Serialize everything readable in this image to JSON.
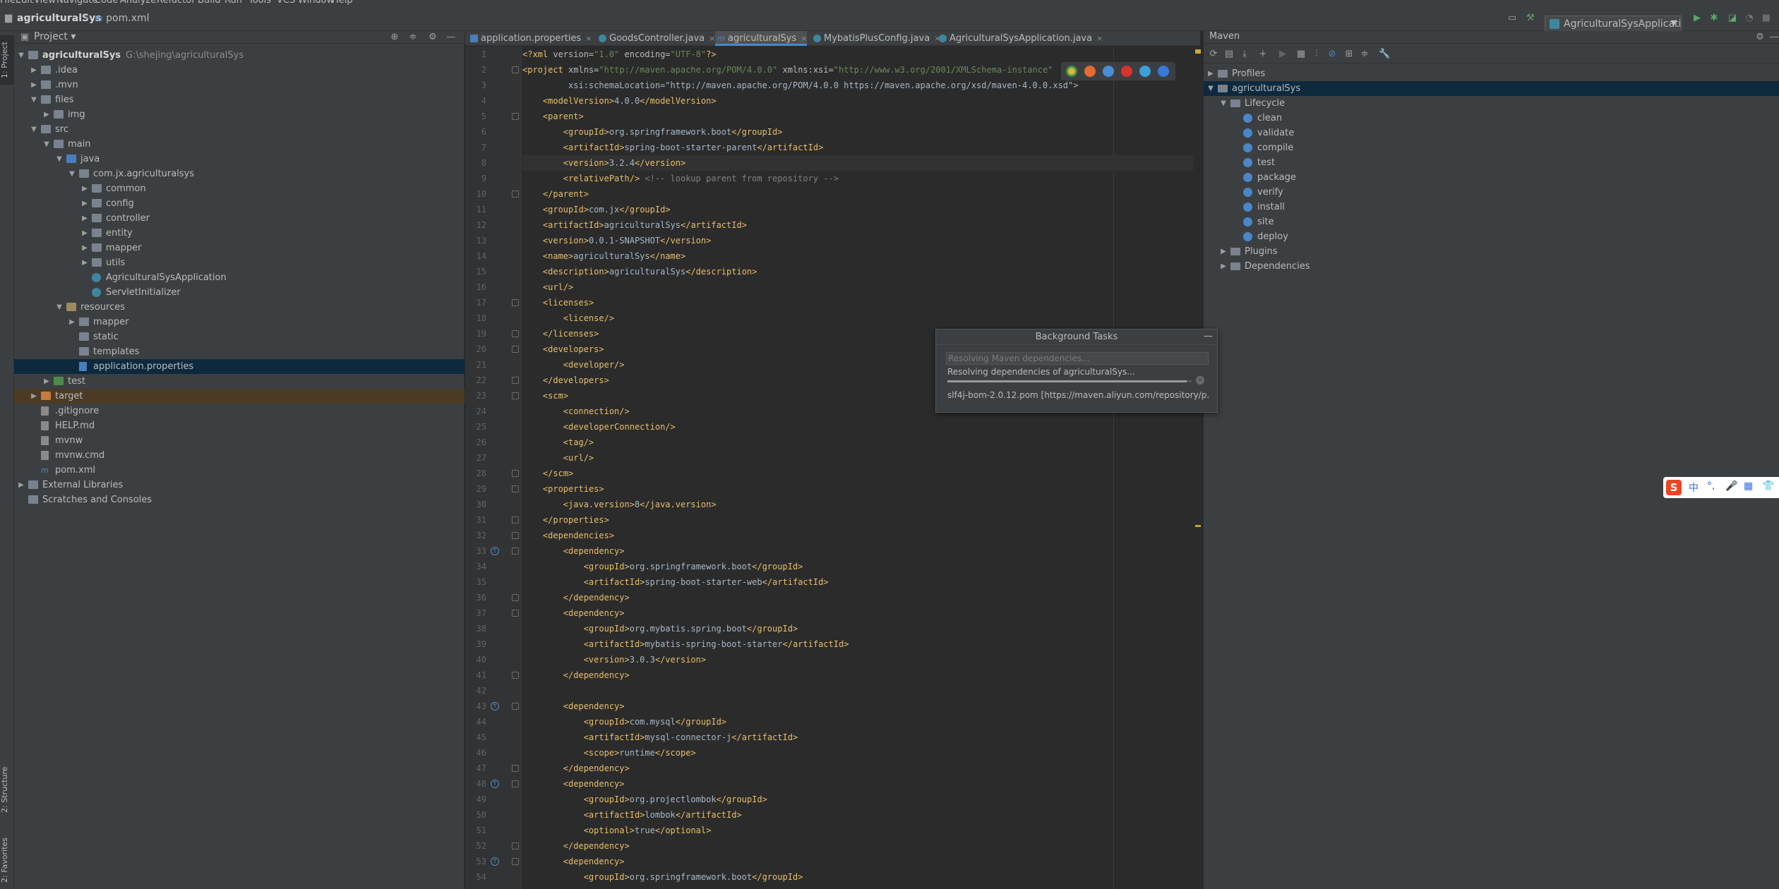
{
  "menu": [
    "File",
    "Edit",
    "View",
    "Navigate",
    "Code",
    "Analyze",
    "Refactor",
    "Build",
    "Run",
    "Tools",
    "VCS",
    "Window",
    "Help"
  ],
  "breadcrumb": {
    "project": "agriculturalSys",
    "file": "pom.xml"
  },
  "run_config": "AgriculturalSysApplication",
  "left_stripe": {
    "project": "1: Project",
    "structure": "2: Structure",
    "favorites": "2: Favorites"
  },
  "project_panel": {
    "title": "Project",
    "tree": [
      {
        "label": "agriculturalSys",
        "path": "G:\\shejing\\agriculturalSys",
        "depth": 0,
        "arrow": "▼",
        "icon": "folder",
        "bold": true
      },
      {
        "label": ".idea",
        "depth": 1,
        "arrow": "▶",
        "icon": "folder"
      },
      {
        "label": ".mvn",
        "depth": 1,
        "arrow": "▶",
        "icon": "folder"
      },
      {
        "label": "files",
        "depth": 1,
        "arrow": "▼",
        "icon": "folder"
      },
      {
        "label": "img",
        "depth": 2,
        "arrow": "▶",
        "icon": "folder"
      },
      {
        "label": "src",
        "depth": 1,
        "arrow": "▼",
        "icon": "folder"
      },
      {
        "label": "main",
        "depth": 2,
        "arrow": "▼",
        "icon": "folder"
      },
      {
        "label": "java",
        "depth": 3,
        "arrow": "▼",
        "icon": "src"
      },
      {
        "label": "com.jx.agriculturalsys",
        "depth": 4,
        "arrow": "▼",
        "icon": "pkg"
      },
      {
        "label": "common",
        "depth": 5,
        "arrow": "▶",
        "icon": "pkg"
      },
      {
        "label": "config",
        "depth": 5,
        "arrow": "▶",
        "icon": "pkg"
      },
      {
        "label": "controller",
        "depth": 5,
        "arrow": "▶",
        "icon": "pkg"
      },
      {
        "label": "entity",
        "depth": 5,
        "arrow": "▶",
        "icon": "pkg"
      },
      {
        "label": "mapper",
        "depth": 5,
        "arrow": "▶",
        "icon": "pkg"
      },
      {
        "label": "utils",
        "depth": 5,
        "arrow": "▶",
        "icon": "pkg"
      },
      {
        "label": "AgriculturalSysApplication",
        "depth": 5,
        "arrow": "",
        "icon": "class"
      },
      {
        "label": "ServletInitializer",
        "depth": 5,
        "arrow": "",
        "icon": "class"
      },
      {
        "label": "resources",
        "depth": 3,
        "arrow": "▼",
        "icon": "res"
      },
      {
        "label": "mapper",
        "depth": 4,
        "arrow": "▶",
        "icon": "folder"
      },
      {
        "label": "static",
        "depth": 4,
        "arrow": "",
        "icon": "folder"
      },
      {
        "label": "templates",
        "depth": 4,
        "arrow": "",
        "icon": "folder"
      },
      {
        "label": "application.properties",
        "depth": 4,
        "arrow": "",
        "icon": "prop",
        "selected": true
      },
      {
        "label": "test",
        "depth": 2,
        "arrow": "▶",
        "icon": "test"
      },
      {
        "label": "target",
        "depth": 1,
        "arrow": "▶",
        "icon": "orange",
        "excluded": true
      },
      {
        "label": ".gitignore",
        "depth": 1,
        "arrow": "",
        "icon": "file"
      },
      {
        "label": "HELP.md",
        "depth": 1,
        "arrow": "",
        "icon": "file"
      },
      {
        "label": "mvnw",
        "depth": 1,
        "arrow": "",
        "icon": "file"
      },
      {
        "label": "mvnw.cmd",
        "depth": 1,
        "arrow": "",
        "icon": "file"
      },
      {
        "label": "pom.xml",
        "depth": 1,
        "arrow": "",
        "icon": "xml"
      },
      {
        "label": "External Libraries",
        "depth": 0,
        "arrow": "▶",
        "icon": "folder"
      },
      {
        "label": "Scratches and Consoles",
        "depth": 0,
        "arrow": "",
        "icon": "folder"
      }
    ]
  },
  "editor_tabs": [
    {
      "label": "application.properties",
      "icon": "prop"
    },
    {
      "label": "GoodsController.java",
      "icon": "class"
    },
    {
      "label": "agriculturalSys",
      "icon": "m",
      "active": true
    },
    {
      "label": "MybatisPlusConfig.java",
      "icon": "class"
    },
    {
      "label": "AgriculturalSysApplication.java",
      "icon": "class"
    }
  ],
  "code_lines": [
    "<?xml version=\"1.0\" encoding=\"UTF-8\"?>",
    "<project xmlns=\"http://maven.apache.org/POM/4.0.0\" xmlns:xsi=\"http://www.w3.org/2001/XMLSchema-instance\"",
    "         xsi:schemaLocation=\"http://maven.apache.org/POM/4.0.0 https://maven.apache.org/xsd/maven-4.0.0.xsd\">",
    "    <modelVersion>4.0.0</modelVersion>",
    "    <parent>",
    "        <groupId>org.springframework.boot</groupId>",
    "        <artifactId>spring-boot-starter-parent</artifactId>",
    "        <version>3.2.4</version>",
    "        <relativePath/> <!-- lookup parent from repository -->",
    "    </parent>",
    "    <groupId>com.jx</groupId>",
    "    <artifactId>agriculturalSys</artifactId>",
    "    <version>0.0.1-SNAPSHOT</version>",
    "    <name>agriculturalSys</name>",
    "    <description>agriculturalSys</description>",
    "    <url/>",
    "    <licenses>",
    "        <license/>",
    "    </licenses>",
    "    <developers>",
    "        <developer/>",
    "    </developers>",
    "    <scm>",
    "        <connection/>",
    "        <developerConnection/>",
    "        <tag/>",
    "        <url/>",
    "    </scm>",
    "    <properties>",
    "        <java.version>8</java.version>",
    "    </properties>",
    "    <dependencies>",
    "        <dependency>",
    "            <groupId>org.springframework.boot</groupId>",
    "            <artifactId>spring-boot-starter-web</artifactId>",
    "        </dependency>",
    "        <dependency>",
    "            <groupId>org.mybatis.spring.boot</groupId>",
    "            <artifactId>mybatis-spring-boot-starter</artifactId>",
    "            <version>3.0.3</version>",
    "        </dependency>",
    "",
    "        <dependency>",
    "            <groupId>com.mysql</groupId>",
    "            <artifactId>mysql-connector-j</artifactId>",
    "            <scope>runtime</scope>",
    "        </dependency>",
    "        <dependency>",
    "            <groupId>org.projectlombok</groupId>",
    "            <artifactId>lombok</artifactId>",
    "            <optional>true</optional>",
    "        </dependency>",
    "        <dependency>",
    "            <groupId>org.springframework.boot</groupId>"
  ],
  "caret_line": 8,
  "maven_panel": {
    "title": "Maven",
    "tree": [
      {
        "label": "Profiles",
        "depth": 0,
        "arrow": "▶",
        "icon": "folder"
      },
      {
        "label": "agriculturalSys",
        "depth": 0,
        "arrow": "▼",
        "icon": "folder",
        "selected": true
      },
      {
        "label": "Lifecycle",
        "depth": 1,
        "arrow": "▼",
        "icon": "folder"
      },
      {
        "label": "clean",
        "depth": 2,
        "arrow": "",
        "icon": "gear"
      },
      {
        "label": "validate",
        "depth": 2,
        "arrow": "",
        "icon": "gear"
      },
      {
        "label": "compile",
        "depth": 2,
        "arrow": "",
        "icon": "gear"
      },
      {
        "label": "test",
        "depth": 2,
        "arrow": "",
        "icon": "gear"
      },
      {
        "label": "package",
        "depth": 2,
        "arrow": "",
        "icon": "gear"
      },
      {
        "label": "verify",
        "depth": 2,
        "arrow": "",
        "icon": "gear"
      },
      {
        "label": "install",
        "depth": 2,
        "arrow": "",
        "icon": "gear"
      },
      {
        "label": "site",
        "depth": 2,
        "arrow": "",
        "icon": "gear"
      },
      {
        "label": "deploy",
        "depth": 2,
        "arrow": "",
        "icon": "gear"
      },
      {
        "label": "Plugins",
        "depth": 1,
        "arrow": "▶",
        "icon": "folder"
      },
      {
        "label": "Dependencies",
        "depth": 1,
        "arrow": "▶",
        "icon": "folder"
      }
    ]
  },
  "background_tasks": {
    "title": "Background Tasks",
    "minimize": "—",
    "line1": "Resolving Maven dependencies...",
    "line2": "Resolving dependencies of agriculturalSys...",
    "line3": "slf4j-bom-2.0.12.pom [https://maven.aliyun.com/repository/p...",
    "progress": 0.98,
    "cancel": "×"
  },
  "ime": {
    "logo": "S",
    "glyphs": [
      "中",
      "°,",
      "🎤",
      "▦",
      "👕"
    ]
  }
}
